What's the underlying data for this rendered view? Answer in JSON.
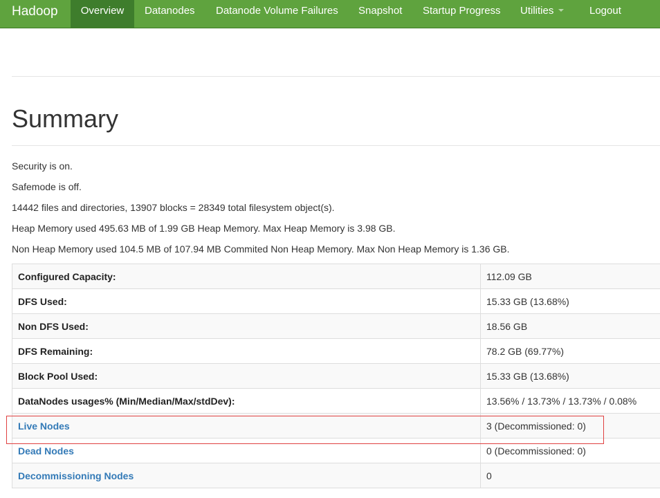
{
  "navbar": {
    "brand": "Hadoop",
    "items": [
      {
        "label": "Overview",
        "active": true
      },
      {
        "label": "Datanodes"
      },
      {
        "label": "Datanode Volume Failures"
      },
      {
        "label": "Snapshot"
      },
      {
        "label": "Startup Progress"
      },
      {
        "label": "Utilities",
        "has_dropdown": true
      },
      {
        "label": "Logout"
      }
    ]
  },
  "summary": {
    "title": "Summary",
    "lines": [
      "Security is on.",
      "Safemode is off.",
      "14442 files and directories, 13907 blocks = 28349 total filesystem object(s).",
      "Heap Memory used 495.63 MB of 1.99 GB Heap Memory. Max Heap Memory is 3.98 GB.",
      "Non Heap Memory used 104.5 MB of 107.94 MB Commited Non Heap Memory. Max Non Heap Memory is 1.36 GB."
    ]
  },
  "table": {
    "rows": [
      {
        "key": "Configured Capacity:",
        "value": "112.09 GB"
      },
      {
        "key": "DFS Used:",
        "value": "15.33 GB (13.68%)"
      },
      {
        "key": "Non DFS Used:",
        "value": "18.56 GB"
      },
      {
        "key": "DFS Remaining:",
        "value": "78.2 GB (69.77%)"
      },
      {
        "key": "Block Pool Used:",
        "value": "15.33 GB (13.68%)"
      },
      {
        "key": "DataNodes usages% (Min/Median/Max/stdDev):",
        "value": "13.56% / 13.73% / 13.73% / 0.08%"
      },
      {
        "key": "Live Nodes",
        "value": "3 (Decommissioned: 0)",
        "is_link": true
      },
      {
        "key": "Dead Nodes",
        "value": "0 (Decommissioned: 0)",
        "is_link": true
      },
      {
        "key": "Decommissioning Nodes",
        "value": "0",
        "is_link": true
      }
    ]
  },
  "colors": {
    "navbar_bg": "#5fa33e",
    "navbar_active": "#3e7d2c",
    "link": "#337ab7",
    "highlight_border": "#e04040"
  }
}
